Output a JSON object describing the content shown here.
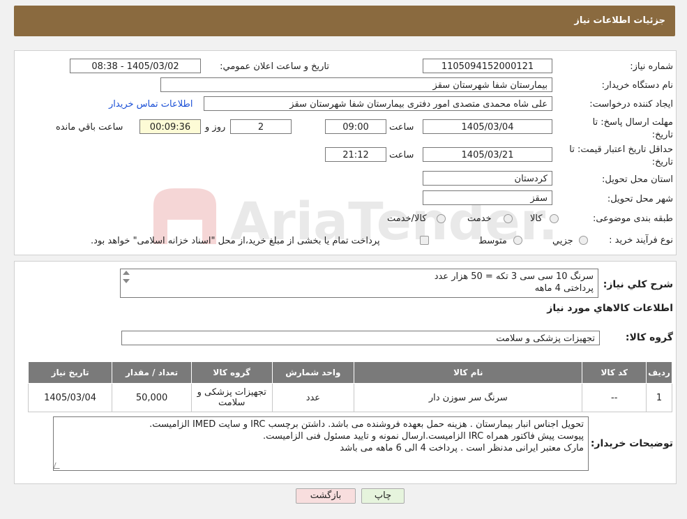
{
  "header": {
    "title": "جزئیات اطلاعات نیاز"
  },
  "form": {
    "need_number_label": "شماره نیاز:",
    "need_number": "1105094152000121",
    "announce_label": "تاریخ و ساعت اعلان عمومي:",
    "announce_value": "1405/03/02 - 08:38",
    "buyer_org_label": "نام دستگاه خريدار:",
    "buyer_org": "بیمارستان شفا شهرستان سقز",
    "creator_label": "ايجاد کننده درخواست:",
    "creator": "علی شاه محمدی متصدی امور دفتری بیمارستان شفا شهرستان سقز",
    "contact_link": "اطلاعات تماس خریدار",
    "deadline_label": "مهلت ارسال پاسخ: تا تاريخ:",
    "deadline_date": "1405/03/04",
    "time_label": "ساعت",
    "deadline_time": "09:00",
    "days_value": "2",
    "days_label": "روز و",
    "remaining_time": "00:09:36",
    "remaining_label": "ساعت باقي مانده",
    "validity_label": "حداقل تاريخ اعتبار قيمت: تا تاريخ:",
    "validity_date": "1405/03/21",
    "validity_time": "21:12",
    "province_label": "استان محل تحويل:",
    "province": "کردستان",
    "city_label": "شهر محل تحويل:",
    "city": "سقز",
    "category_label": "طبقه بندی موضوعی:",
    "category_options": [
      "کالا",
      "خدمت",
      "کالا/خدمت"
    ],
    "process_label": "نوع فرآيند خريد :",
    "process_options": [
      "جزيي",
      "متوسط"
    ],
    "process_note": "پرداخت تمام يا بخشی از مبلغ خريد،از محل \"اسناد خزانه اسلامی\" خواهد بود."
  },
  "details": {
    "summary_label": "شرح کلي نياز:",
    "summary_lines": [
      "سرنگ 10 سی سی 3 تکه = 50 هزار عدد",
      "پرداختی 4 ماهه"
    ],
    "goods_info_title": "اطلاعات کالاهاي مورد نياز",
    "goods_group_label": "گروه کالا:",
    "goods_group": "تجهیزات پزشکی و سلامت",
    "table": {
      "headers": [
        "رديف",
        "کد کالا",
        "نام کالا",
        "واحد شمارش",
        "گروه کالا",
        "تعداد / مقدار",
        "تاريخ نياز"
      ],
      "rows": [
        [
          "1",
          "--",
          "سرنگ سر سوزن دار",
          "عدد",
          "تجهیزات پزشکی و سلامت",
          "50,000",
          "1405/03/04"
        ]
      ]
    },
    "buyer_notes_label": "توضيحات خريدار:",
    "buyer_notes_lines": [
      "تحویل اجناس  انبار بیمارستان . هزینه حمل بعهده فروشنده می باشد.  داشتن برچسب IRC  و سایت  IMED  الزامیست.",
      "پیوست پیش فاکتور همراه IRC  الزامیست.ارسال نمونه و تایید مسئول فنی الزامیست.",
      "مارک معتبر ایرانی مدنظر است . پرداخت 4 الی 6 ماهه می باشد"
    ]
  },
  "buttons": {
    "print": "چاپ",
    "back": "بازگشت"
  },
  "watermark": {
    "text": "AriaTender.neT"
  },
  "colors": {
    "header": "#8a6a3f",
    "link": "#1a4fd6",
    "table_header": "#7a7a7a"
  }
}
